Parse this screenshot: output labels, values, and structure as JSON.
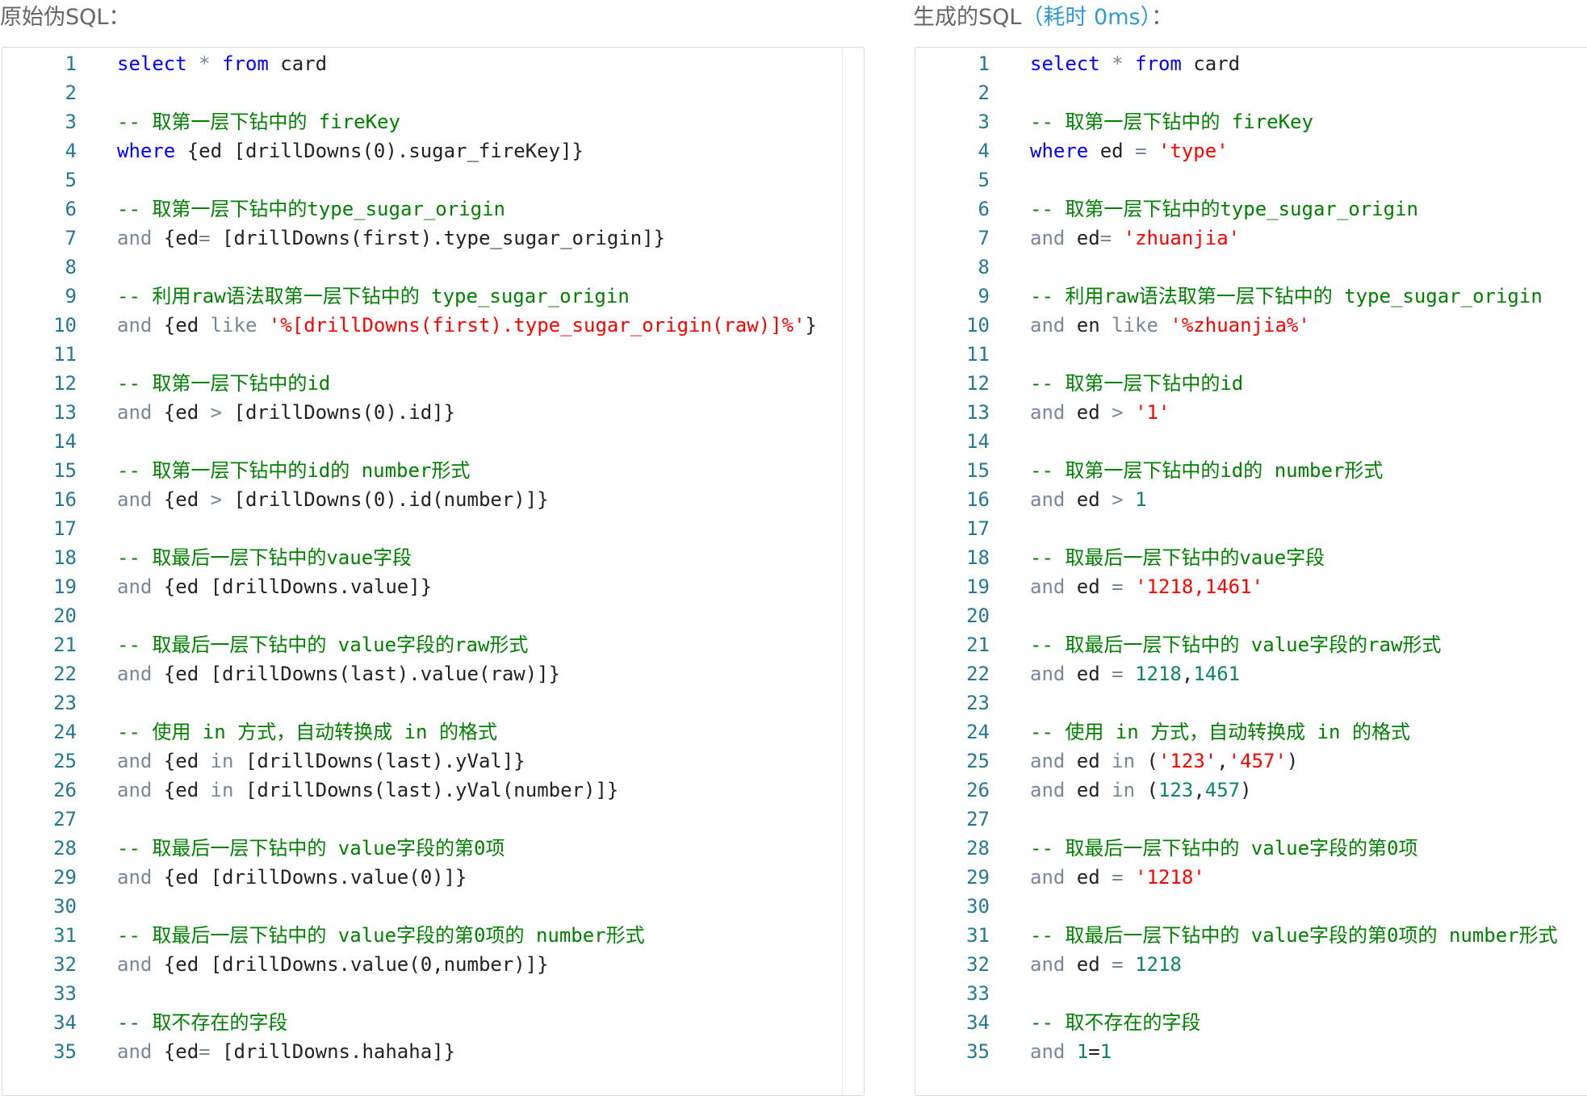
{
  "left_panel": {
    "label": "原始伪SQL："
  },
  "right_panel": {
    "label": "生成的SQL",
    "timing": "（耗时 0ms）",
    "label_suffix": "："
  },
  "colors": {
    "keyword": "#0000ff",
    "operator": "#778899",
    "comment": "#008000",
    "string": "#ff0000",
    "number": "#09885a",
    "plain": "#222222",
    "line_number": "#237893"
  },
  "original_sql": [
    [
      [
        "kw",
        "select"
      ],
      [
        "op",
        " * "
      ],
      [
        "kw",
        "from"
      ],
      [
        "pl",
        " card"
      ]
    ],
    [],
    [
      [
        "cm",
        "-- 取第一层下钻中的 fireKey"
      ]
    ],
    [
      [
        "kw",
        "where"
      ],
      [
        "pl",
        " {ed [drillDowns(0).sugar_fireKey]}"
      ]
    ],
    [],
    [
      [
        "cm",
        "-- 取第一层下钻中的type_sugar_origin"
      ]
    ],
    [
      [
        "op",
        "and"
      ],
      [
        "pl",
        " {ed"
      ],
      [
        "op",
        "="
      ],
      [
        "pl",
        " [drillDowns(first).type_sugar_origin]}"
      ]
    ],
    [],
    [
      [
        "cm",
        "-- 利用raw语法取第一层下钻中的 type_sugar_origin"
      ]
    ],
    [
      [
        "op",
        "and"
      ],
      [
        "pl",
        " {ed "
      ],
      [
        "op",
        "like"
      ],
      [
        "pl",
        " "
      ],
      [
        "st",
        "'%[drillDowns(first).type_sugar_origin(raw)]%'"
      ],
      [
        "pl",
        "}"
      ]
    ],
    [],
    [
      [
        "cm",
        "-- 取第一层下钻中的id"
      ]
    ],
    [
      [
        "op",
        "and"
      ],
      [
        "pl",
        " {ed "
      ],
      [
        "op",
        ">"
      ],
      [
        "pl",
        " [drillDowns(0).id]}"
      ]
    ],
    [],
    [
      [
        "cm",
        "-- 取第一层下钻中的id的 number形式"
      ]
    ],
    [
      [
        "op",
        "and"
      ],
      [
        "pl",
        " {ed "
      ],
      [
        "op",
        ">"
      ],
      [
        "pl",
        " [drillDowns(0).id(number)]}"
      ]
    ],
    [],
    [
      [
        "cm",
        "-- 取最后一层下钻中的vaue字段"
      ]
    ],
    [
      [
        "op",
        "and"
      ],
      [
        "pl",
        " {ed [drillDowns.value]}"
      ]
    ],
    [],
    [
      [
        "cm",
        "-- 取最后一层下钻中的 value字段的raw形式"
      ]
    ],
    [
      [
        "op",
        "and"
      ],
      [
        "pl",
        " {ed [drillDowns(last).value(raw)]}"
      ]
    ],
    [],
    [
      [
        "cm",
        "-- 使用 in 方式，自动转换成 in 的格式"
      ]
    ],
    [
      [
        "op",
        "and"
      ],
      [
        "pl",
        " {ed "
      ],
      [
        "op",
        "in"
      ],
      [
        "pl",
        " [drillDowns(last).yVal]}"
      ]
    ],
    [
      [
        "op",
        "and"
      ],
      [
        "pl",
        " {ed "
      ],
      [
        "op",
        "in"
      ],
      [
        "pl",
        " [drillDowns(last).yVal(number)]}"
      ]
    ],
    [],
    [
      [
        "cm",
        "-- 取最后一层下钻中的 value字段的第0项"
      ]
    ],
    [
      [
        "op",
        "and"
      ],
      [
        "pl",
        " {ed [drillDowns.value(0)]}"
      ]
    ],
    [],
    [
      [
        "cm",
        "-- 取最后一层下钻中的 value字段的第0项的 number形式"
      ]
    ],
    [
      [
        "op",
        "and"
      ],
      [
        "pl",
        " {ed [drillDowns.value(0,number)]}"
      ]
    ],
    [],
    [
      [
        "cm",
        "-- 取不存在的字段"
      ]
    ],
    [
      [
        "op",
        "and"
      ],
      [
        "pl",
        " {ed"
      ],
      [
        "op",
        "="
      ],
      [
        "pl",
        " [drillDowns.hahaha]}"
      ]
    ]
  ],
  "generated_sql": [
    [
      [
        "kw",
        "select"
      ],
      [
        "op",
        " * "
      ],
      [
        "kw",
        "from"
      ],
      [
        "pl",
        " card"
      ]
    ],
    [],
    [
      [
        "cm",
        "-- 取第一层下钻中的 fireKey"
      ]
    ],
    [
      [
        "kw",
        "where"
      ],
      [
        "pl",
        " ed "
      ],
      [
        "op",
        "="
      ],
      [
        "pl",
        " "
      ],
      [
        "st",
        "'type'"
      ]
    ],
    [],
    [
      [
        "cm",
        "-- 取第一层下钻中的type_sugar_origin"
      ]
    ],
    [
      [
        "op",
        "and"
      ],
      [
        "pl",
        " ed"
      ],
      [
        "op",
        "="
      ],
      [
        "pl",
        " "
      ],
      [
        "st",
        "'zhuanjia'"
      ]
    ],
    [],
    [
      [
        "cm",
        "-- 利用raw语法取第一层下钻中的 type_sugar_origin"
      ]
    ],
    [
      [
        "op",
        "and"
      ],
      [
        "pl",
        " en "
      ],
      [
        "op",
        "like"
      ],
      [
        "pl",
        " "
      ],
      [
        "st",
        "'%zhuanjia%'"
      ]
    ],
    [],
    [
      [
        "cm",
        "-- 取第一层下钻中的id"
      ]
    ],
    [
      [
        "op",
        "and"
      ],
      [
        "pl",
        " ed "
      ],
      [
        "op",
        ">"
      ],
      [
        "pl",
        " "
      ],
      [
        "st",
        "'1'"
      ]
    ],
    [],
    [
      [
        "cm",
        "-- 取第一层下钻中的id的 number形式"
      ]
    ],
    [
      [
        "op",
        "and"
      ],
      [
        "pl",
        " ed "
      ],
      [
        "op",
        ">"
      ],
      [
        "pl",
        " "
      ],
      [
        "nm",
        "1"
      ]
    ],
    [],
    [
      [
        "cm",
        "-- 取最后一层下钻中的vaue字段"
      ]
    ],
    [
      [
        "op",
        "and"
      ],
      [
        "pl",
        " ed "
      ],
      [
        "op",
        "="
      ],
      [
        "pl",
        " "
      ],
      [
        "st",
        "'1218,1461'"
      ]
    ],
    [],
    [
      [
        "cm",
        "-- 取最后一层下钻中的 value字段的raw形式"
      ]
    ],
    [
      [
        "op",
        "and"
      ],
      [
        "pl",
        " ed "
      ],
      [
        "op",
        "="
      ],
      [
        "pl",
        " "
      ],
      [
        "nm",
        "1218"
      ],
      [
        "pl",
        ","
      ],
      [
        "nm",
        "1461"
      ]
    ],
    [],
    [
      [
        "cm",
        "-- 使用 in 方式，自动转换成 in 的格式"
      ]
    ],
    [
      [
        "op",
        "and"
      ],
      [
        "pl",
        " ed "
      ],
      [
        "op",
        "in"
      ],
      [
        "pl",
        " ("
      ],
      [
        "st",
        "'123'"
      ],
      [
        "pl",
        ","
      ],
      [
        "st",
        "'457'"
      ],
      [
        "pl",
        ")"
      ]
    ],
    [
      [
        "op",
        "and"
      ],
      [
        "pl",
        " ed "
      ],
      [
        "op",
        "in"
      ],
      [
        "pl",
        " ("
      ],
      [
        "nm",
        "123"
      ],
      [
        "pl",
        ","
      ],
      [
        "nm",
        "457"
      ],
      [
        "pl",
        ")"
      ]
    ],
    [],
    [
      [
        "cm",
        "-- 取最后一层下钻中的 value字段的第0项"
      ]
    ],
    [
      [
        "op",
        "and"
      ],
      [
        "pl",
        " ed "
      ],
      [
        "op",
        "="
      ],
      [
        "pl",
        " "
      ],
      [
        "st",
        "'1218'"
      ]
    ],
    [],
    [
      [
        "cm",
        "-- 取最后一层下钻中的 value字段的第0项的 number形式"
      ]
    ],
    [
      [
        "op",
        "and"
      ],
      [
        "pl",
        " ed "
      ],
      [
        "op",
        "="
      ],
      [
        "pl",
        " "
      ],
      [
        "nm",
        "1218"
      ]
    ],
    [],
    [
      [
        "cm",
        "-- 取不存在的字段"
      ]
    ],
    [
      [
        "op",
        "and"
      ],
      [
        "pl",
        " "
      ],
      [
        "nm",
        "1"
      ],
      [
        "pl",
        "="
      ],
      [
        "nm",
        "1"
      ]
    ]
  ]
}
